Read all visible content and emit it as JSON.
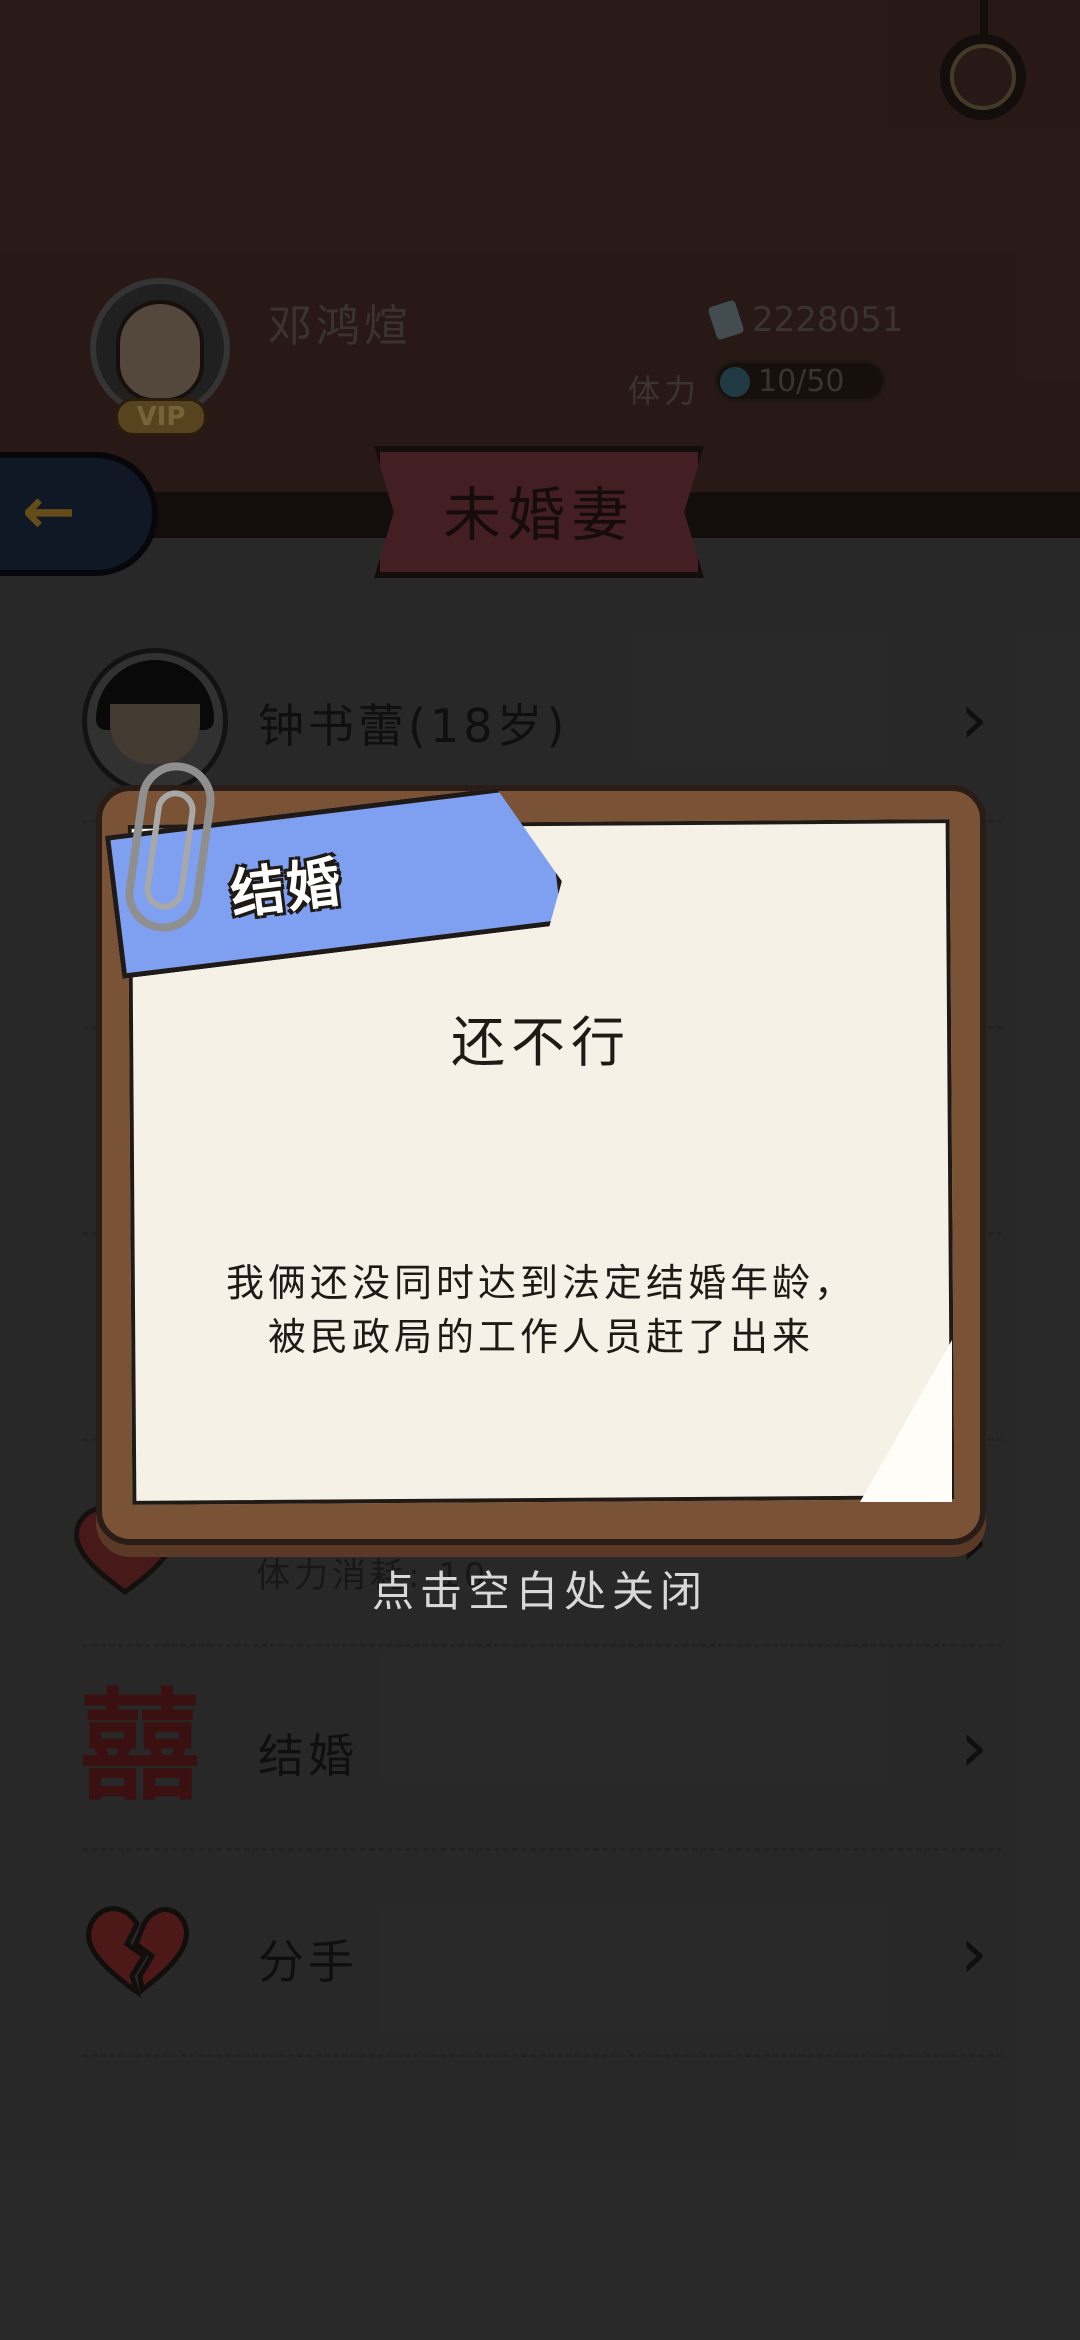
{
  "header": {
    "player_name": "邓鸿煊",
    "vip_label": "VIP",
    "money": "2228051",
    "stamina_label": "体力",
    "stamina_text": "10/50"
  },
  "page_title": "未婚妻",
  "fiancee": {
    "name_age": "钟书蕾(18岁)"
  },
  "list": {
    "stamina_cost_text": "体力消耗: 10",
    "marry_label": "结婚",
    "breakup_label": "分手"
  },
  "modal": {
    "ribbon_label": "结婚",
    "title": "还不行",
    "body_line1": "我俩还没同时达到法定结婚年龄，",
    "body_line2": "被民政局的工作人员赶了出来",
    "close_hint": "点击空白处关闭"
  },
  "colors": {
    "header_bg": "#4a2e2a",
    "ribbon": "#7f9ff0",
    "board": "#7a5236",
    "paper": "#f6f1e6",
    "title_banner": "#7a3a42"
  },
  "icons": [
    "ring-icon",
    "back-arrow-icon",
    "money-icon",
    "wife-avatar",
    "double-happiness-icon",
    "broken-heart-icon",
    "heart-icon",
    "chevron-right-icon",
    "paperclip-icon"
  ]
}
